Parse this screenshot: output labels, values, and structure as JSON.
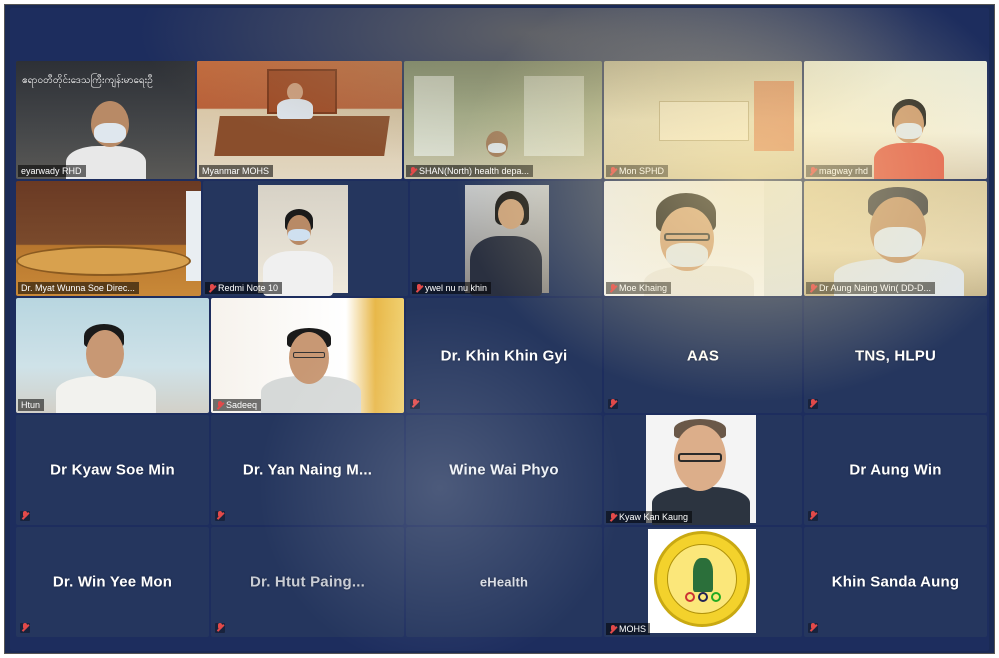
{
  "meeting": {
    "header_text": "ဧရာဝတီတိုင်းဒေသကြီးကျန်းမာရေးဦ",
    "participants": [
      {
        "name": "eyarwady RHD",
        "type": "video"
      },
      {
        "name": "Myanmar MOHS",
        "type": "video",
        "active_speaker": true
      },
      {
        "name": "SHAN(North) health depa...",
        "type": "video"
      },
      {
        "name": "Mon SPHD",
        "type": "video"
      },
      {
        "name": "magway rhd",
        "type": "video"
      },
      {
        "name": "Dr. Myat Wunna Soe Direc...",
        "type": "video"
      },
      {
        "name": "Redmi Note 10",
        "type": "video"
      },
      {
        "name": "ywel nu nu khin",
        "type": "video"
      },
      {
        "name": "Moe Khaing",
        "type": "video"
      },
      {
        "name": "Dr Aung Naing Win( DD-D...",
        "type": "video"
      },
      {
        "name": "Htun",
        "type": "video"
      },
      {
        "name": "Sadeeq",
        "type": "video"
      },
      {
        "name": "Dr. Khin Khin Gyi",
        "type": "name"
      },
      {
        "name": "AAS",
        "type": "name"
      },
      {
        "name": "TNS, HLPU",
        "type": "name"
      },
      {
        "name": "Dr Kyaw Soe Min",
        "type": "name"
      },
      {
        "name": "Dr. Yan Naing M...",
        "type": "name"
      },
      {
        "name": "Wine Wai Phyo",
        "type": "name"
      },
      {
        "name": "Kyaw Kan Kaung",
        "type": "photo"
      },
      {
        "name": "Dr Aung Win",
        "type": "name"
      },
      {
        "name": "Dr. Win Yee Mon",
        "type": "name"
      },
      {
        "name": "Dr. Htut Paing...",
        "type": "name"
      },
      {
        "name": "eHealth",
        "type": "name"
      },
      {
        "name": "MOHS",
        "type": "logo",
        "logo_text": "MINISTRY OF HEALTH AND SPORTS"
      },
      {
        "name": "Khin Sanda Aung",
        "type": "name"
      }
    ]
  },
  "colors": {
    "tile_bg": "#23355f",
    "active_outline": "#d6e06a",
    "muted_mic": "#e24a4a"
  }
}
